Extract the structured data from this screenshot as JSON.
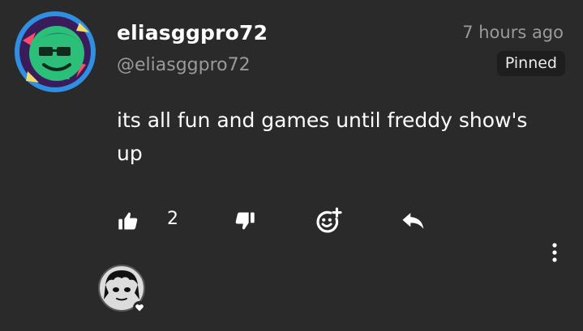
{
  "comment": {
    "username": "eliasggpro72",
    "handle": "@eliasggpro72",
    "timestamp": "7 hours ago",
    "pinned_label": "Pinned",
    "text": "its all fun and games until freddy show's up",
    "like_count": "2"
  },
  "icons": {
    "like": "thumbs-up-icon",
    "dislike": "thumbs-down-icon",
    "react": "emoji-add-icon",
    "reply": "reply-icon",
    "more": "more-vertical-icon",
    "heart": "heart-icon"
  },
  "colors": {
    "background": "#2a2a2a",
    "text": "#ffffff",
    "muted": "#9a9a9a",
    "pinned_bg": "#1e1e1e"
  }
}
